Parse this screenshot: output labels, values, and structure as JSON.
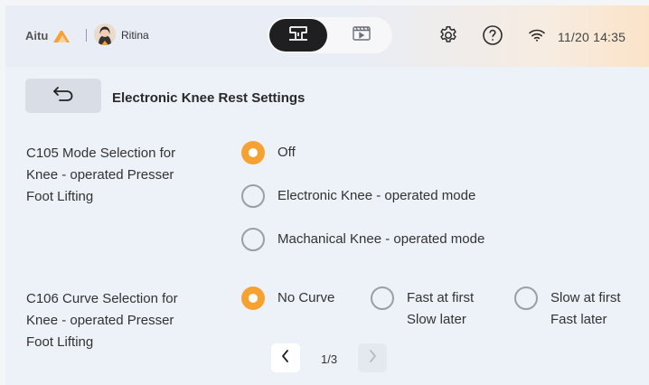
{
  "header": {
    "brand": "Aitu",
    "user_name": "Ritina",
    "time": "11/20 14:35",
    "icons": {
      "mode_sewing": "sewing-machine-icon",
      "mode_video": "video-tutorial-icon",
      "settings": "gear-icon",
      "help": "help-icon",
      "wifi": "wifi-icon"
    },
    "active_mode": "sewing"
  },
  "page": {
    "title": "Electronic Knee Rest Settings",
    "back_icon": "back-arrow-icon"
  },
  "settings": [
    {
      "code": "C105",
      "label_lines": [
        "C105 Mode Selection for",
        "Knee - operated Presser",
        "Foot Lifting"
      ],
      "options": [
        {
          "label": "Off",
          "selected": true
        },
        {
          "label": "Electronic Knee - operated mode",
          "selected": false
        },
        {
          "label": "Machanical Knee - operated mode",
          "selected": false
        }
      ]
    },
    {
      "code": "C106",
      "label_lines": [
        "C106 Curve Selection for",
        "Knee - operated Presser",
        "Foot Lifting"
      ],
      "options": [
        {
          "lines": [
            "No Curve"
          ],
          "selected": true
        },
        {
          "lines": [
            "Fast at first",
            "Slow later"
          ],
          "selected": false
        },
        {
          "lines": [
            "Slow at first",
            "Fast later"
          ],
          "selected": false
        }
      ]
    }
  ],
  "pagination": {
    "label": "1/3",
    "current": 1,
    "total": 3
  },
  "colors": {
    "accent": "#f6a233",
    "active_segment": "#1f1f21",
    "radio_border": "#9a9ea6"
  }
}
